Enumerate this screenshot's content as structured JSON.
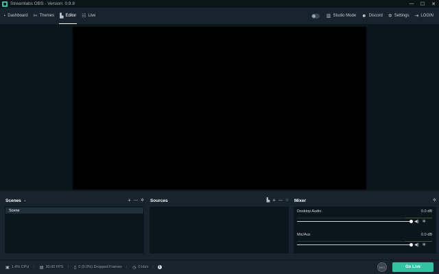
{
  "window": {
    "title": "Streamlabs OBS - Version: 0.9.8",
    "minimize_glyph": "—",
    "maximize_glyph": "☐",
    "close_glyph": "✕"
  },
  "nav": {
    "left": [
      {
        "label": "Dashboard",
        "icon": "dashboard-icon",
        "glyph": "◔",
        "active": false
      },
      {
        "label": "Themes",
        "icon": "themes-icon",
        "glyph": "✄",
        "active": false
      },
      {
        "label": "Editor",
        "icon": "editor-icon",
        "glyph": "▙",
        "active": true
      },
      {
        "label": "Live",
        "icon": "live-icon",
        "glyph": "☷",
        "active": false
      }
    ],
    "right": [
      {
        "label": "Studio Mode",
        "icon": "studio-mode-icon",
        "glyph": "▥"
      },
      {
        "label": "Discord",
        "icon": "discord-icon",
        "glyph": "☻"
      },
      {
        "label": "Settings",
        "icon": "gear-icon",
        "glyph": "✲"
      },
      {
        "label": "LOGIN",
        "icon": "login-icon",
        "glyph": "⇥"
      }
    ]
  },
  "scenes": {
    "title": "Scenes",
    "dropdown_glyph": "⌄",
    "add_glyph": "+",
    "remove_glyph": "—",
    "settings_glyph": "✲",
    "items": [
      "Scene"
    ]
  },
  "sources": {
    "title": "Sources",
    "folder_glyph": "▙",
    "add_glyph": "+",
    "remove_glyph": "—",
    "settings_glyph": "✲"
  },
  "mixer": {
    "title": "Mixer",
    "settings_glyph": "✲",
    "volume_glyph": "◀)",
    "gear_glyph": "✲",
    "channels": [
      {
        "name": "Desktop Audio",
        "db": "0.0 dB",
        "level": 1.0
      },
      {
        "name": "Mic/Aux",
        "db": "0.0 dB",
        "level": 1.0
      }
    ]
  },
  "footer": {
    "cpu": "1.4% CPU",
    "fps": "30.00 FPS",
    "dropped": "0 (0.0%) Dropped Frames",
    "bitrate": "0 kb/s",
    "sep_glyph": "|",
    "info_glyph": "i",
    "rec_label": "REC",
    "go_live": "Go Live"
  },
  "colors": {
    "accent": "#31c3a2",
    "background": "#17242d",
    "panel": "#0b161c",
    "preview": "#000000"
  }
}
